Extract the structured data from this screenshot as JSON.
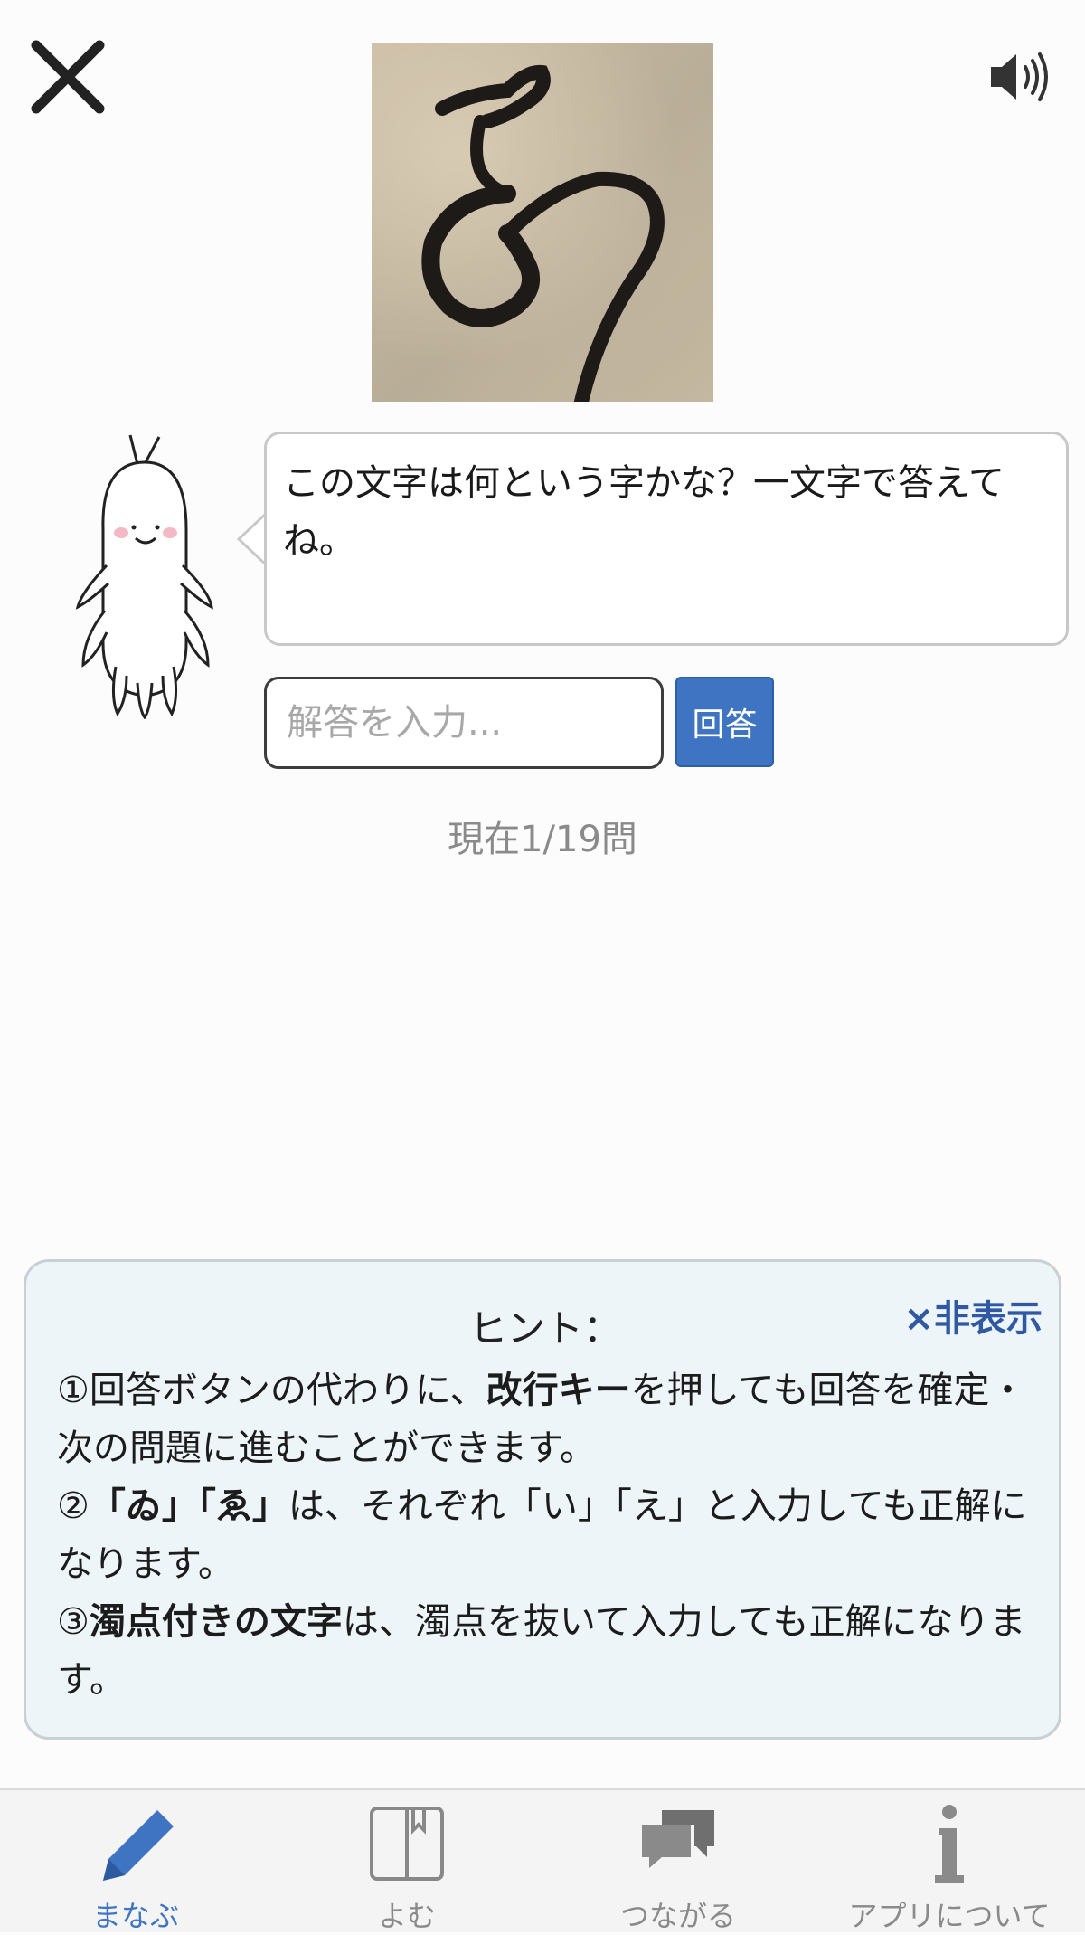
{
  "question": {
    "text": "この文字は何という字かな？一文字で答えてね。",
    "progress": "現在1/19問"
  },
  "answer": {
    "placeholder": "解答を入力...",
    "button_label": "回答"
  },
  "hint": {
    "title": "ヒント：",
    "hide_label": "×非表示",
    "items": [
      {
        "prefix": "①回答ボタンの代わりに、",
        "bold": "改行キー",
        "suffix": "を押しても回答を確定・次の問題に進むことができます。"
      },
      {
        "prefix": "②",
        "bold": "「ゐ」「ゑ」",
        "suffix": "は、それぞれ「い」「え」と入力しても正解になります。"
      },
      {
        "prefix": "③",
        "bold": "濁点付きの文字",
        "suffix": "は、濁点を抜いて入力しても正解になります。"
      }
    ]
  },
  "tabs": [
    {
      "label": "まなぶ",
      "icon": "pencil-icon",
      "active": true
    },
    {
      "label": "よむ",
      "icon": "book-icon",
      "active": false
    },
    {
      "label": "つながる",
      "icon": "chat-bubbles-icon",
      "active": false
    },
    {
      "label": "アプリについて",
      "icon": "info-icon",
      "active": false
    }
  ],
  "colors": {
    "accent": "#3f74c3",
    "hint_background": "#eef5f8",
    "hide_link": "#2f5aa3"
  }
}
